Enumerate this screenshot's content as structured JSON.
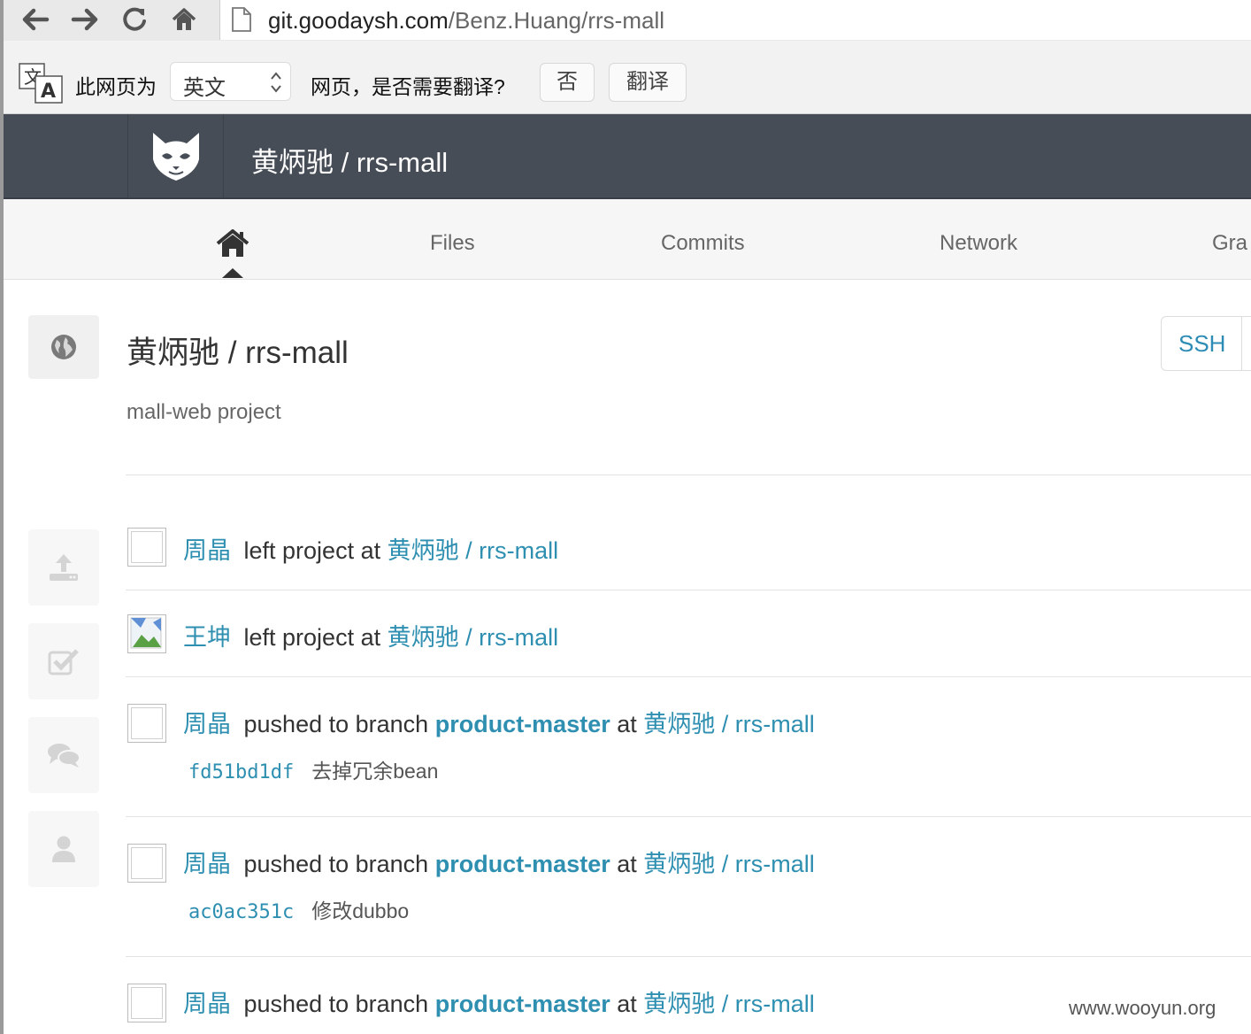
{
  "browser": {
    "url_host": "git.goodaysh.com",
    "url_path": "/Benz.Huang/rrs-mall",
    "icons": [
      "back-icon",
      "forward-icon",
      "reload-icon",
      "home-icon",
      "page-icon"
    ]
  },
  "translate_bar": {
    "prefix": "此网页为",
    "language": "英文",
    "question": "网页，是否需要翻译?",
    "no_label": "否",
    "translate_label": "翻译"
  },
  "header": {
    "title": "黄炳驰 / rrs-mall"
  },
  "nav": {
    "tabs": [
      {
        "label": "Files"
      },
      {
        "label": "Commits"
      },
      {
        "label": "Network"
      },
      {
        "label": "Gra"
      }
    ]
  },
  "project": {
    "title": "黄炳驰 / rrs-mall",
    "description": "mall-web project",
    "clone_label": "SSH"
  },
  "sidebar": {
    "icons": [
      "globe-icon",
      "upload-icon",
      "checkbox-icon",
      "comments-icon",
      "user-icon"
    ]
  },
  "events": [
    {
      "author": "周晶",
      "action": "left project",
      "at": "at",
      "project": "黄炳驰 / rrs-mall"
    },
    {
      "author": "王坤",
      "action": "left project",
      "at": "at",
      "project": "黄炳驰 / rrs-mall"
    },
    {
      "author": "周晶",
      "action": "pushed to branch",
      "branch": "product-master",
      "at": "at",
      "project": "黄炳驰 / rrs-mall",
      "commit": {
        "sha": "fd51bd1df",
        "message": "去掉冗余bean"
      }
    },
    {
      "author": "周晶",
      "action": "pushed to branch",
      "branch": "product-master",
      "at": "at",
      "project": "黄炳驰 / rrs-mall",
      "commit": {
        "sha": "ac0ac351c",
        "message": "修改dubbo"
      }
    },
    {
      "author": "周晶",
      "action": "pushed to branch",
      "branch": "product-master",
      "at": "at",
      "project": "黄炳驰 / rrs-mall"
    }
  ],
  "watermark": "www.wooyun.org",
  "colors": {
    "header_bg": "#474d57",
    "link": "#2e8fb1"
  }
}
